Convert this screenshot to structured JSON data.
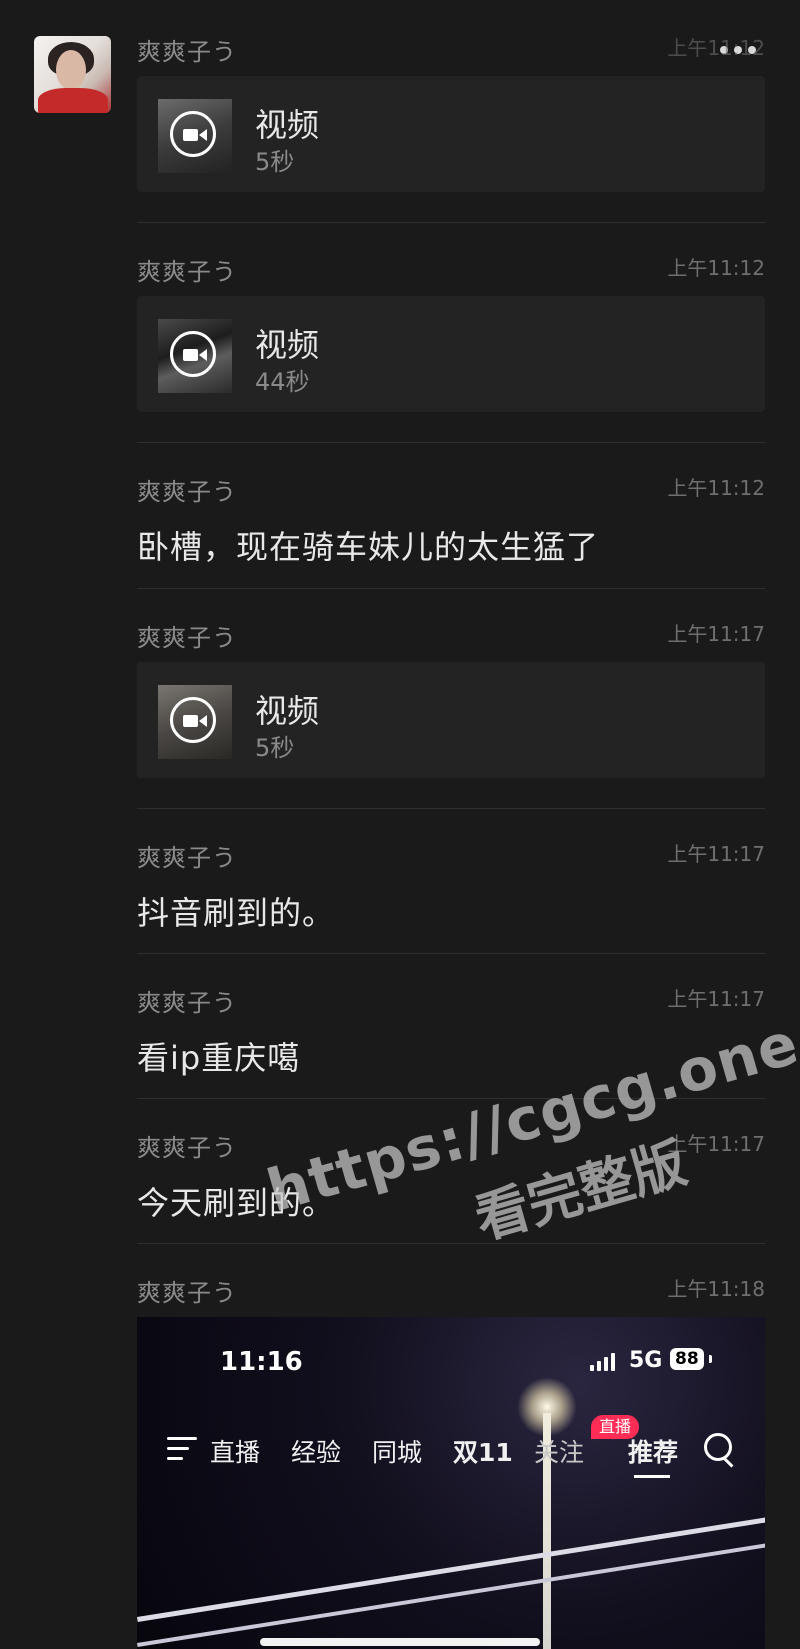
{
  "chat": {
    "avatar_icon": "user-avatar-photo",
    "more_icon": "more-dots-icon",
    "messages": [
      {
        "sender": "爽爽子う",
        "time": "上午11:12",
        "type": "video",
        "video_label": "视频",
        "duration": "5秒"
      },
      {
        "sender": "爽爽子う",
        "time": "上午11:12",
        "type": "video",
        "video_label": "视频",
        "duration": "44秒"
      },
      {
        "sender": "爽爽子う",
        "time": "上午11:12",
        "type": "text",
        "text": "卧槽，现在骑车妹儿的太生猛了"
      },
      {
        "sender": "爽爽子う",
        "time": "上午11:17",
        "type": "video",
        "video_label": "视频",
        "duration": "5秒"
      },
      {
        "sender": "爽爽子う",
        "time": "上午11:17",
        "type": "text",
        "text": "抖音刷到的。"
      },
      {
        "sender": "爽爽子う",
        "time": "上午11:17",
        "type": "text",
        "text": "看ip重庆噶"
      },
      {
        "sender": "爽爽子う",
        "time": "上午11:17",
        "type": "text",
        "text": "今天刷到的。"
      },
      {
        "sender": "爽爽子う",
        "time": "上午11:18",
        "type": "image"
      }
    ]
  },
  "screenshot_image": {
    "clock": "11:16",
    "network": "5G",
    "battery": "88",
    "tabs": [
      "直播",
      "经验",
      "同城",
      "双11",
      "关注",
      "推荐"
    ],
    "badge": "直播",
    "active_tab": "推荐"
  },
  "watermark": {
    "line1": "https://cgcg.one",
    "line2": "看完整版"
  }
}
